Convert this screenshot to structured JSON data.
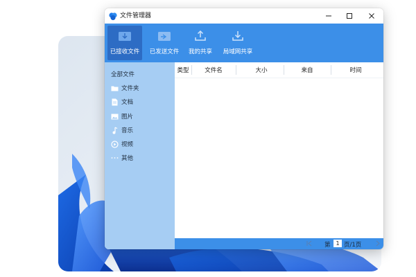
{
  "window": {
    "title": "文件管理器"
  },
  "toolbar": {
    "items": [
      {
        "label": "已接收文件",
        "icon": "inbox-icon",
        "active": true
      },
      {
        "label": "已发送文件",
        "icon": "outbox-icon",
        "active": false
      },
      {
        "label": "我的共享",
        "icon": "upload-icon",
        "active": false
      },
      {
        "label": "局域网共享",
        "icon": "download-icon",
        "active": false
      }
    ]
  },
  "sidebar": {
    "header": "全部文件",
    "items": [
      {
        "label": "文件夹",
        "icon": "folder-icon"
      },
      {
        "label": "文档",
        "icon": "document-icon"
      },
      {
        "label": "图片",
        "icon": "image-icon"
      },
      {
        "label": "音乐",
        "icon": "music-icon"
      },
      {
        "label": "视频",
        "icon": "video-icon"
      },
      {
        "label": "其他",
        "icon": "more-icon"
      }
    ]
  },
  "table": {
    "columns": [
      "类型",
      "文件名",
      "大小",
      "来自",
      "时间"
    ],
    "rows": []
  },
  "pager": {
    "first_icon": "first-page-icon",
    "prefix": "第",
    "page": "1",
    "suffix": "页/1页",
    "next_icon": "next-page-icon"
  },
  "colors": {
    "toolbar": "#3c8fe8",
    "toolbar_active": "#2d6cc4",
    "sidebar": "#a6cdf3",
    "content": "#ffffff"
  }
}
